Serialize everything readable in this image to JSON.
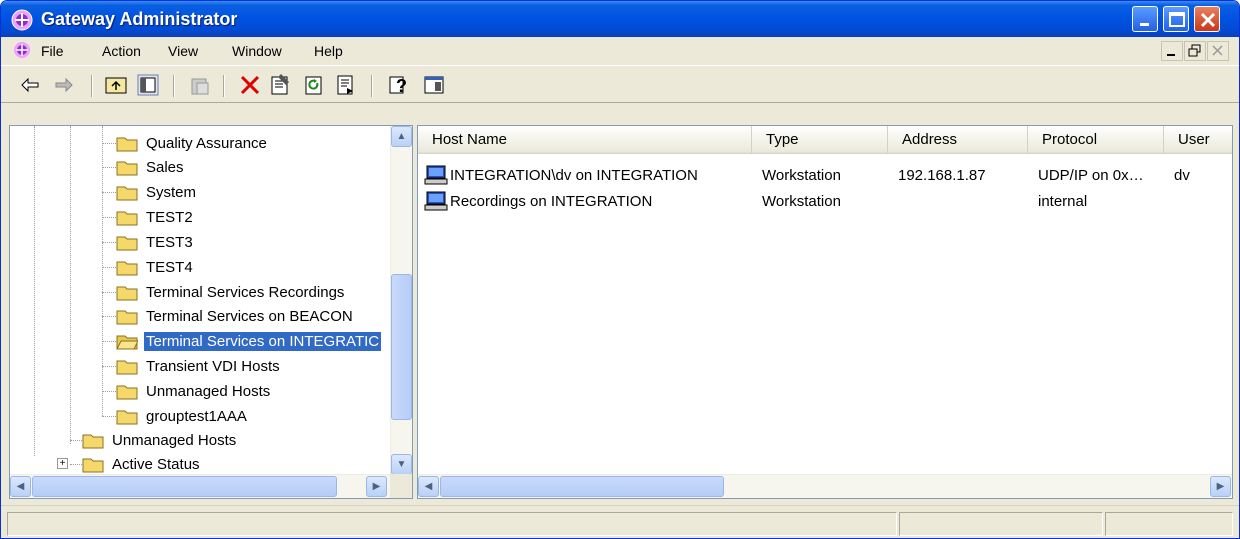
{
  "window": {
    "title": "Gateway Administrator"
  },
  "menu": {
    "items": [
      "File",
      "Action",
      "View",
      "Window",
      "Help"
    ]
  },
  "toolbar": {
    "buttons": [
      "back-icon",
      "forward-icon",
      "up-folder-icon",
      "show-hide-tree-icon",
      "paste-icon",
      "delete-icon",
      "properties-icon",
      "refresh-icon",
      "export-list-icon",
      "help-icon",
      "console-pane-icon"
    ]
  },
  "tree": {
    "items": [
      {
        "label": "Quality Assurance"
      },
      {
        "label": "Sales"
      },
      {
        "label": "System"
      },
      {
        "label": "TEST2"
      },
      {
        "label": "TEST3"
      },
      {
        "label": "TEST4"
      },
      {
        "label": "Terminal Services Recordings"
      },
      {
        "label": "Terminal Services on BEACON"
      },
      {
        "label": "Terminal Services on INTEGRATIC",
        "selected": true
      },
      {
        "label": "Transient VDI Hosts"
      },
      {
        "label": "Unmanaged Hosts"
      },
      {
        "label": "grouptest1AAA"
      },
      {
        "label": "Unmanaged Hosts"
      },
      {
        "label": "Active Status",
        "expander": "+"
      }
    ]
  },
  "list": {
    "columns": [
      "Host Name",
      "Type",
      "Address",
      "Protocol",
      "User"
    ],
    "rows": [
      {
        "host": "INTEGRATION\\dv on INTEGRATION",
        "type": "Workstation",
        "address": "192.168.1.87",
        "protocol": "UDP/IP on 0x…",
        "user": "dv"
      },
      {
        "host": "Recordings on INTEGRATION",
        "type": "Workstation",
        "address": "",
        "protocol": "internal",
        "user": ""
      }
    ]
  },
  "statusbar": {
    "panels": [
      "",
      "",
      ""
    ]
  },
  "colors": {
    "selection": "#316ac5",
    "titlebar": "#0054e3"
  }
}
